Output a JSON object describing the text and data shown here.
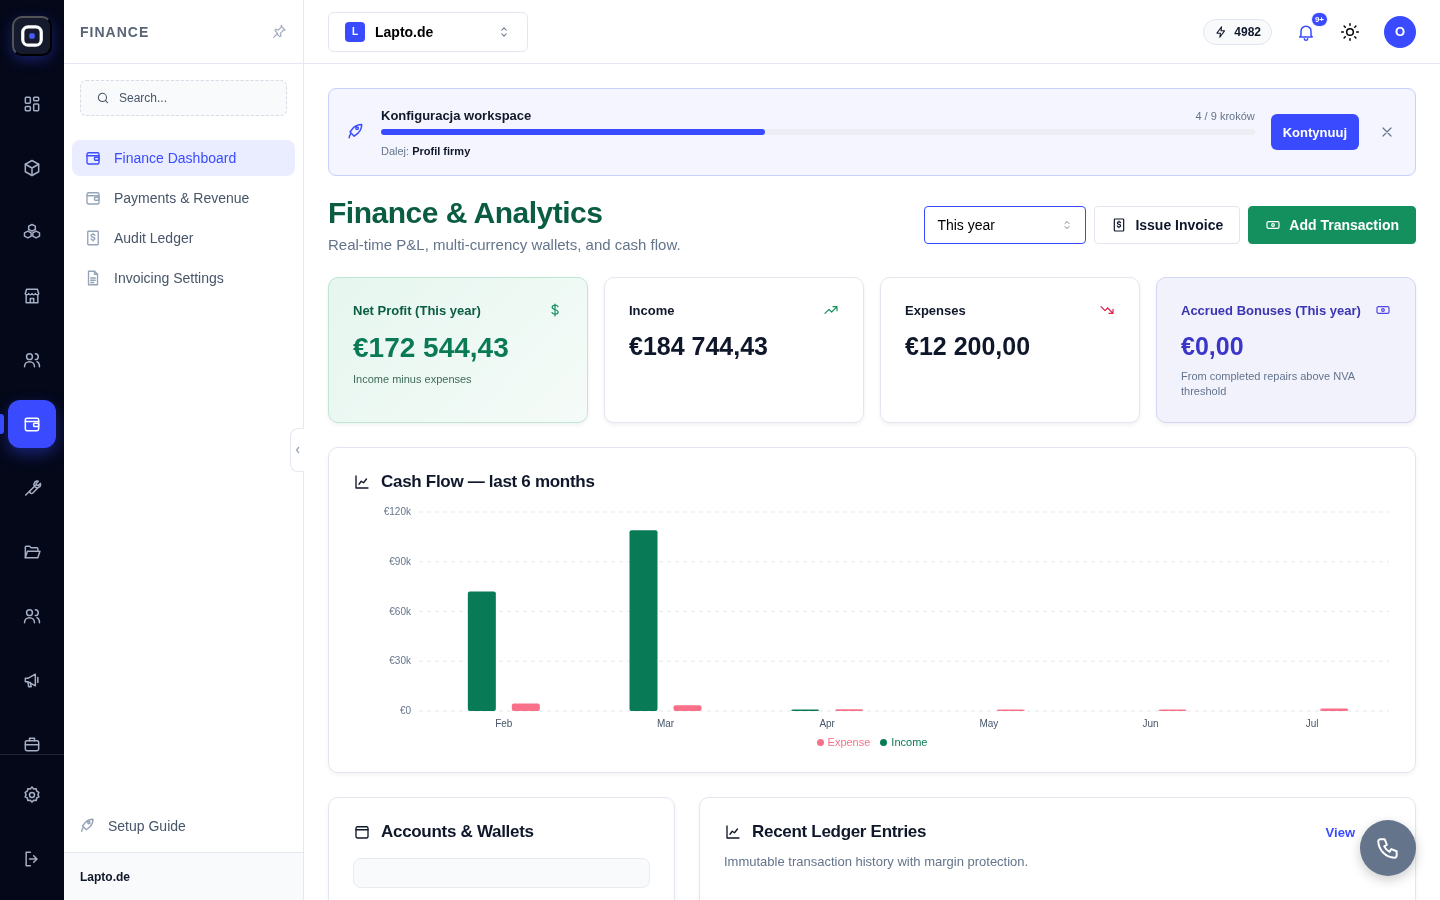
{
  "rail": {
    "items": [
      {
        "selected": false
      },
      {
        "selected": false
      },
      {
        "selected": false
      },
      {
        "selected": false
      },
      {
        "selected": false
      },
      {
        "selected": true
      },
      {
        "selected": false
      },
      {
        "selected": false
      },
      {
        "selected": false
      },
      {
        "selected": false
      },
      {
        "selected": false
      }
    ]
  },
  "sidebar": {
    "title": "FINANCE",
    "search": {
      "placeholder": "Search..."
    },
    "items": [
      {
        "label": "Finance Dashboard",
        "selected": true
      },
      {
        "label": "Payments & Revenue",
        "selected": false
      },
      {
        "label": "Audit Ledger",
        "selected": false
      },
      {
        "label": "Invoicing Settings",
        "selected": false
      }
    ],
    "setup_guide": "Setup Guide",
    "footer": "Lapto.de"
  },
  "topbar": {
    "workspace": {
      "initial": "L",
      "name": "Lapto.de"
    },
    "credits": "4982",
    "notifications_badge": "9+",
    "avatar": "O"
  },
  "setup_banner": {
    "title": "Konfiguracja workspace",
    "steps": "4 / 9 kroków",
    "level": 0.44,
    "next": "Dalej: **Profil firmy**",
    "button": "Kontynuuj"
  },
  "header": {
    "title": "Finance & Analytics",
    "subtitle": "Real-time P&L, multi-currency wallets, and cash flow.",
    "period": "This year",
    "buttons": [
      {
        "label": "Issue Invoice",
        "kind": "secondary"
      },
      {
        "label": "Add Transaction",
        "kind": "primary"
      }
    ]
  },
  "stats": [
    {
      "kind": "profit",
      "label": "Net Profit (This year)",
      "value": "€172 544,43",
      "note": "Income minus expenses"
    },
    {
      "kind": "plain",
      "label": "Income",
      "value": "€184 744,43"
    },
    {
      "kind": "plain",
      "label": "Expenses",
      "value": "€12 200,00"
    },
    {
      "kind": "bonus",
      "label": "Accrued Bonuses (This year)",
      "value": "€0,00",
      "note": "From completed repairs above NVA threshold"
    }
  ],
  "cash_flow": {
    "title": "Cash Flow — last 6 months",
    "chart_data": {
      "type": "bar",
      "categories": [
        "Feb",
        "Mar",
        "Apr",
        "May",
        "Jun",
        "Jul"
      ],
      "series": [
        {
          "name": "Income",
          "color": "#087a56",
          "values": [
            72000,
            109000,
            800,
            null,
            null,
            null
          ]
        },
        {
          "name": "Expense",
          "color": "#f87189",
          "values": [
            4500,
            3500,
            1000,
            400,
            300,
            1500
          ]
        }
      ],
      "ylim": [
        0,
        120000
      ],
      "grid": true,
      "legend": "bottom",
      "yticks": [
        {
          "value": 0,
          "label": "€0"
        },
        {
          "value": 30000,
          "label": "€30k"
        },
        {
          "value": 60000,
          "label": "€60k"
        },
        {
          "value": 90000,
          "label": "€90k"
        },
        {
          "value": 120000,
          "label": "€120k"
        }
      ]
    }
  },
  "accounts": {
    "title": "Accounts & Wallets"
  },
  "ledger": {
    "title": "Recent Ledger Entries",
    "link": "View",
    "subtitle": "Immutable transaction history with margin protection."
  }
}
